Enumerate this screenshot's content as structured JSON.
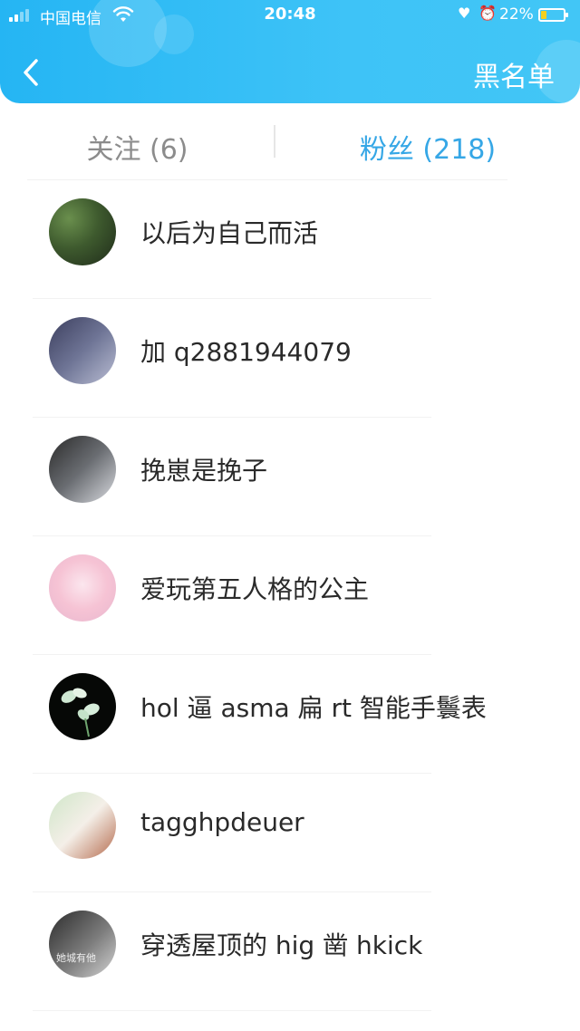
{
  "status_bar": {
    "carrier": "中国电信",
    "time": "20:48",
    "battery_percent": "22%",
    "battery_level": 0.22,
    "signal_bars_filled": 2,
    "signal_bars_total": 4
  },
  "nav": {
    "title": "黑名单"
  },
  "tabs": [
    {
      "label": "关注 (6)",
      "active": false
    },
    {
      "label": "粉丝 (218)",
      "active": true
    }
  ],
  "followers": [
    {
      "name": "以后为自己而活"
    },
    {
      "name": "加 q2881944079"
    },
    {
      "name": "挽崽是挽子"
    },
    {
      "name": "爱玩第五人格的公主"
    },
    {
      "name": "hol 逼 asma 扁 rt 智能手鬟表"
    },
    {
      "name": "tagghpdeuer"
    },
    {
      "name": "穿透屋顶的 hig 凿 hkick",
      "avatar_text": "她城有他"
    }
  ],
  "colors": {
    "header": "#2ab8f5",
    "active_tab": "#36a7e6",
    "inactive_tab": "#8c8c8c",
    "battery_fill": "#f3d020"
  }
}
